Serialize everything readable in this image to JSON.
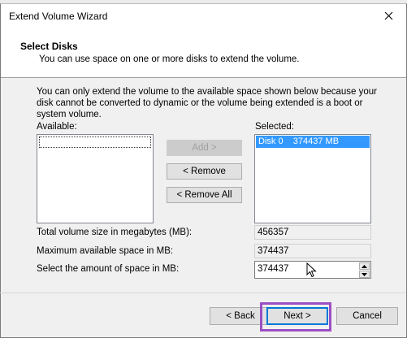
{
  "window": {
    "title": "Extend Volume Wizard"
  },
  "header": {
    "title": "Select Disks",
    "subtitle": "You can use space on one or more disks to extend the volume."
  },
  "description": "You can only extend the volume to the available space shown below because your disk cannot be converted to dynamic or the volume being extended is a boot or system volume.",
  "available": {
    "label": "Available:"
  },
  "selected": {
    "label": "Selected:",
    "items": [
      {
        "disk": "Disk 0",
        "size": "374437 MB"
      }
    ]
  },
  "buttons": {
    "add": "Add >",
    "remove": "< Remove",
    "remove_all": "< Remove All",
    "back": "< Back",
    "next": "Next >",
    "cancel": "Cancel"
  },
  "fields": {
    "total_label": "Total volume size in megabytes (MB):",
    "total_value": "456357",
    "max_label": "Maximum available space in MB:",
    "max_value": "374437",
    "amount_label": "Select the amount of space in MB:",
    "amount_value": "374437"
  },
  "colors": {
    "selection": "#3399ff",
    "highlight": "#9b4fc4",
    "default_button": "#0078d7"
  },
  "icons": {
    "close": "close-icon",
    "spin_up": "arrow-up-icon",
    "spin_down": "arrow-down-icon",
    "cursor": "mouse-cursor-icon"
  }
}
